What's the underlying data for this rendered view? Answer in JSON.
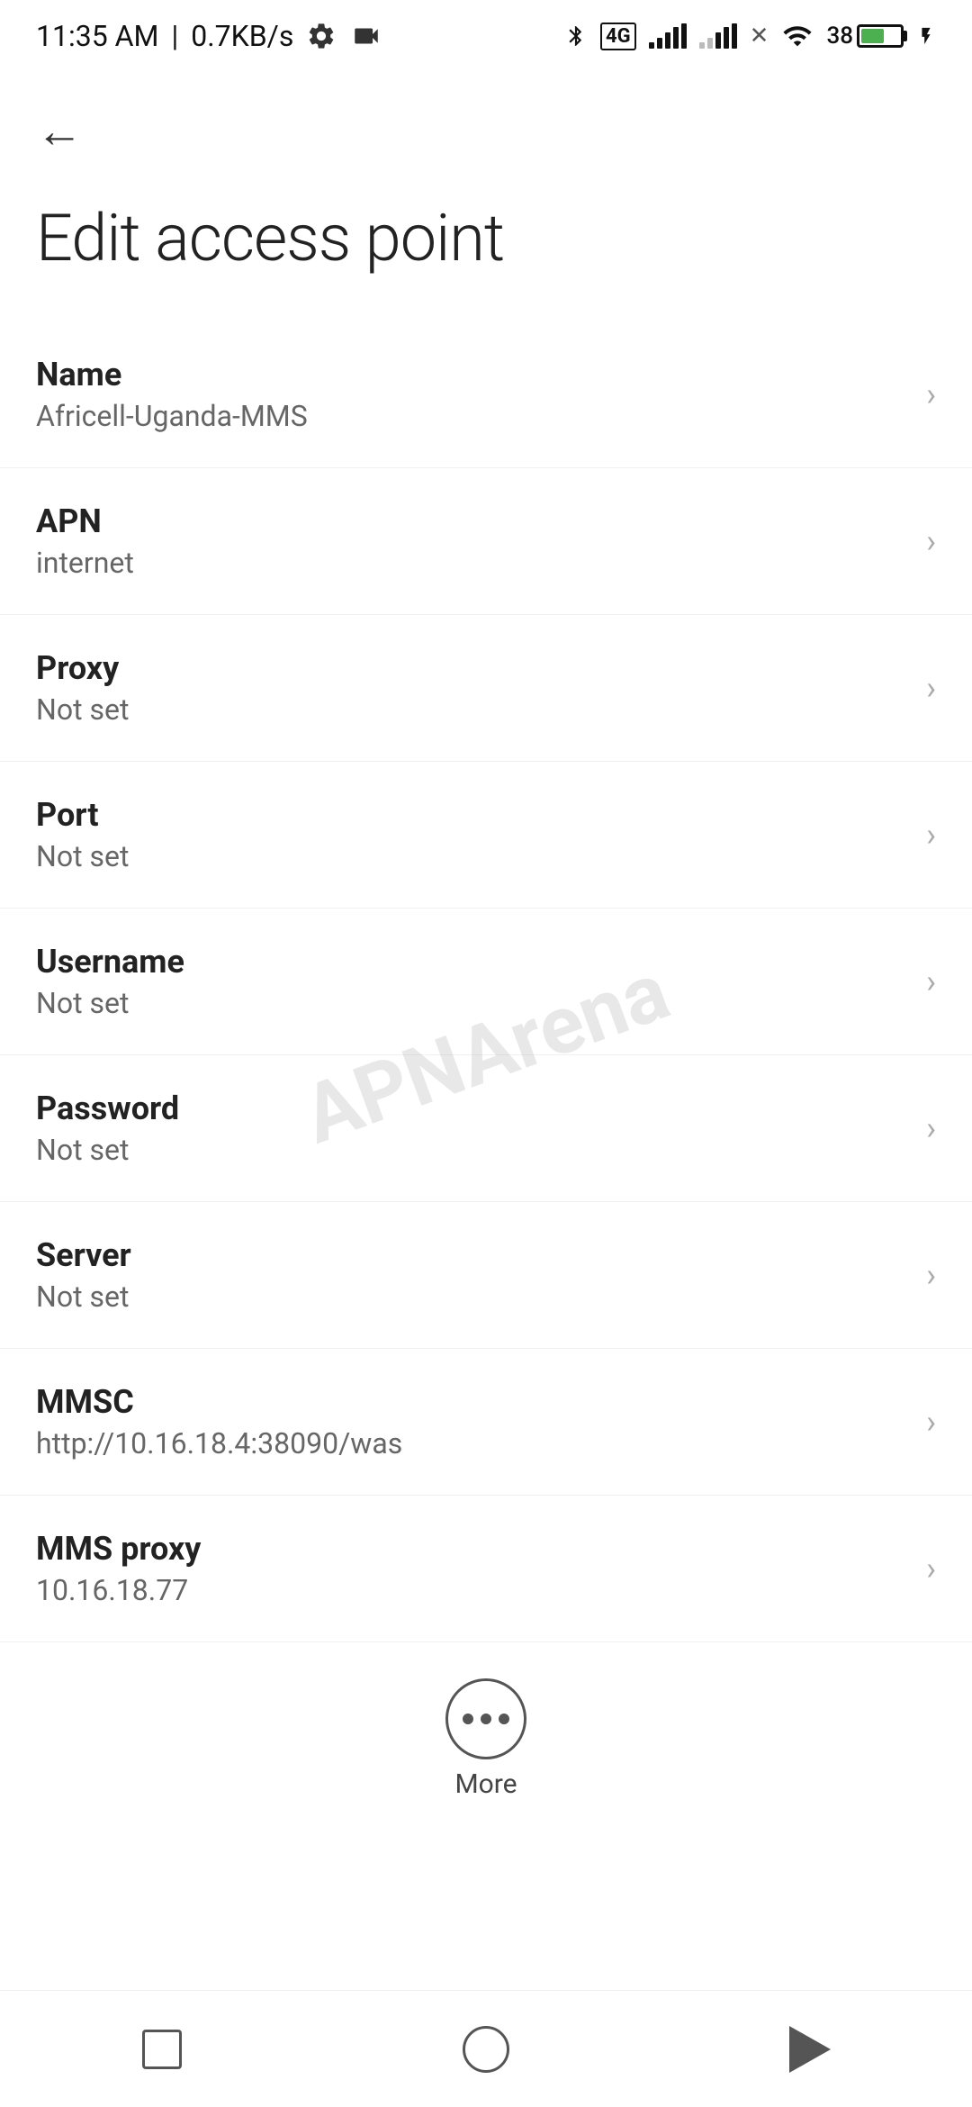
{
  "statusBar": {
    "time": "11:35 AM",
    "speed": "0.7KB/s"
  },
  "header": {
    "backLabel": "←",
    "title": "Edit access point"
  },
  "fields": [
    {
      "label": "Name",
      "value": "Africell-Uganda-MMS"
    },
    {
      "label": "APN",
      "value": "internet"
    },
    {
      "label": "Proxy",
      "value": "Not set"
    },
    {
      "label": "Port",
      "value": "Not set"
    },
    {
      "label": "Username",
      "value": "Not set"
    },
    {
      "label": "Password",
      "value": "Not set"
    },
    {
      "label": "Server",
      "value": "Not set"
    },
    {
      "label": "MMSC",
      "value": "http://10.16.18.4:38090/was"
    },
    {
      "label": "MMS proxy",
      "value": "10.16.18.77"
    }
  ],
  "more": {
    "label": "More"
  },
  "battery": {
    "percent": "38"
  }
}
